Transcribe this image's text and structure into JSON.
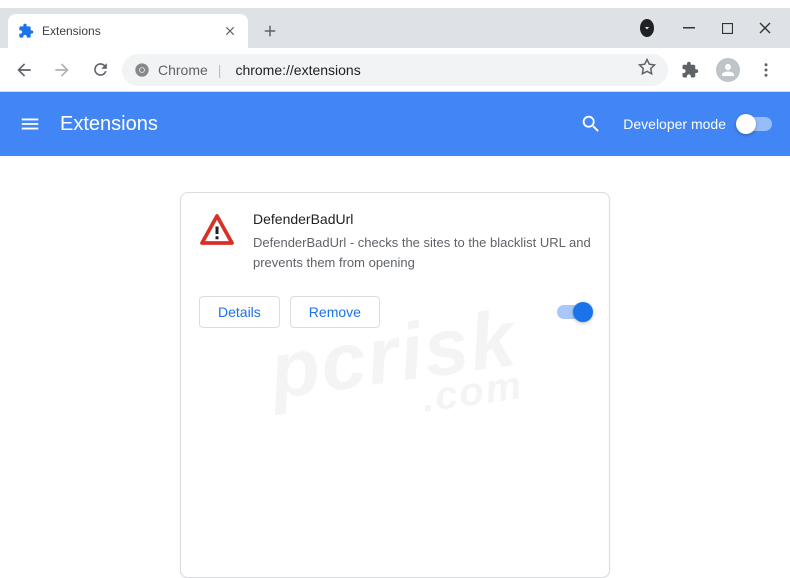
{
  "window": {
    "tab_title": "Extensions"
  },
  "omnibox": {
    "prefix": "Chrome",
    "url": "chrome://extensions"
  },
  "header": {
    "title": "Extensions",
    "dev_mode_label": "Developer mode",
    "dev_mode_enabled": false
  },
  "extension": {
    "name": "DefenderBadUrl",
    "description": "DefenderBadUrl - checks the sites to the blacklist URL and prevents them from opening",
    "details_label": "Details",
    "remove_label": "Remove",
    "enabled": true
  },
  "watermark": {
    "main": "pcrisk",
    "sub": ".com"
  }
}
